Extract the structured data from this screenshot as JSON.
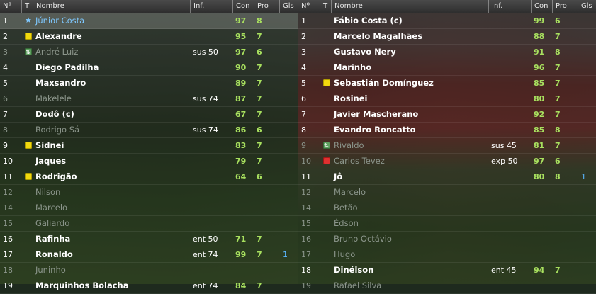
{
  "columns": {
    "num": "Nº",
    "t": "T",
    "name": "Nombre",
    "inf": "Inf.",
    "con": "Con",
    "pro": "Pro",
    "gls": "Gls"
  },
  "left_team": [
    {
      "num": "1",
      "icon": "star",
      "name": "Júnior Costa",
      "inf": "",
      "con": "97",
      "pro": "8",
      "gls": "",
      "style": "accent",
      "selected": true
    },
    {
      "num": "2",
      "icon": "yellow",
      "name": "Alexandre",
      "inf": "",
      "con": "95",
      "pro": "7",
      "gls": "",
      "style": "normal"
    },
    {
      "num": "3",
      "icon": "sub",
      "name": "André Luiz",
      "inf": "sus 50",
      "con": "97",
      "pro": "6",
      "gls": "",
      "style": "dim"
    },
    {
      "num": "4",
      "icon": "",
      "name": "Diego Padilha",
      "inf": "",
      "con": "90",
      "pro": "7",
      "gls": "",
      "style": "normal"
    },
    {
      "num": "5",
      "icon": "",
      "name": "Maxsandro",
      "inf": "",
      "con": "89",
      "pro": "7",
      "gls": "",
      "style": "normal"
    },
    {
      "num": "6",
      "icon": "",
      "name": "Makelele",
      "inf": "sus 74",
      "con": "87",
      "pro": "7",
      "gls": "",
      "style": "dim"
    },
    {
      "num": "7",
      "icon": "",
      "name": "Dodô (c)",
      "inf": "",
      "con": "67",
      "pro": "7",
      "gls": "",
      "style": "normal"
    },
    {
      "num": "8",
      "icon": "",
      "name": "Rodrigo Sá",
      "inf": "sus 74",
      "con": "86",
      "pro": "6",
      "gls": "",
      "style": "dim"
    },
    {
      "num": "9",
      "icon": "yellow",
      "name": "Sidnei",
      "inf": "",
      "con": "83",
      "pro": "7",
      "gls": "",
      "style": "normal"
    },
    {
      "num": "10",
      "icon": "",
      "name": "Jaques",
      "inf": "",
      "con": "79",
      "pro": "7",
      "gls": "",
      "style": "normal"
    },
    {
      "num": "11",
      "icon": "yellow",
      "name": "Rodrigão",
      "inf": "",
      "con": "64",
      "pro": "6",
      "gls": "",
      "style": "normal"
    },
    {
      "num": "12",
      "icon": "",
      "name": "Nilson",
      "inf": "",
      "con": "",
      "pro": "",
      "gls": "",
      "style": "dim"
    },
    {
      "num": "14",
      "icon": "",
      "name": "Marcelo",
      "inf": "",
      "con": "",
      "pro": "",
      "gls": "",
      "style": "dim"
    },
    {
      "num": "15",
      "icon": "",
      "name": "Galiardo",
      "inf": "",
      "con": "",
      "pro": "",
      "gls": "",
      "style": "dim"
    },
    {
      "num": "16",
      "icon": "",
      "name": "Rafinha",
      "inf": "ent 50",
      "con": "71",
      "pro": "7",
      "gls": "",
      "style": "normal"
    },
    {
      "num": "17",
      "icon": "",
      "name": "Ronaldo",
      "inf": "ent 74",
      "con": "99",
      "pro": "7",
      "gls": "1",
      "style": "normal"
    },
    {
      "num": "18",
      "icon": "",
      "name": "Juninho",
      "inf": "",
      "con": "",
      "pro": "",
      "gls": "",
      "style": "dim"
    },
    {
      "num": "19",
      "icon": "",
      "name": "Marquinhos Bolacha",
      "inf": "ent 74",
      "con": "84",
      "pro": "7",
      "gls": "",
      "style": "normal"
    }
  ],
  "right_team": [
    {
      "num": "1",
      "icon": "",
      "name": "Fábio Costa (c)",
      "inf": "",
      "con": "99",
      "pro": "6",
      "gls": "",
      "style": "normal"
    },
    {
      "num": "2",
      "icon": "",
      "name": "Marcelo Magalhães",
      "inf": "",
      "con": "88",
      "pro": "7",
      "gls": "",
      "style": "normal"
    },
    {
      "num": "3",
      "icon": "",
      "name": "Gustavo Nery",
      "inf": "",
      "con": "91",
      "pro": "8",
      "gls": "",
      "style": "normal"
    },
    {
      "num": "4",
      "icon": "",
      "name": "Marinho",
      "inf": "",
      "con": "96",
      "pro": "7",
      "gls": "",
      "style": "normal"
    },
    {
      "num": "5",
      "icon": "yellow",
      "name": "Sebastián Domínguez",
      "inf": "",
      "con": "85",
      "pro": "7",
      "gls": "",
      "style": "normal"
    },
    {
      "num": "6",
      "icon": "",
      "name": "Rosinei",
      "inf": "",
      "con": "80",
      "pro": "7",
      "gls": "",
      "style": "normal"
    },
    {
      "num": "7",
      "icon": "",
      "name": "Javier Mascherano",
      "inf": "",
      "con": "92",
      "pro": "7",
      "gls": "",
      "style": "normal"
    },
    {
      "num": "8",
      "icon": "",
      "name": "Evandro Roncatto",
      "inf": "",
      "con": "85",
      "pro": "8",
      "gls": "",
      "style": "normal"
    },
    {
      "num": "9",
      "icon": "sub",
      "name": "Rivaldo",
      "inf": "sus 45",
      "con": "81",
      "pro": "7",
      "gls": "",
      "style": "dim"
    },
    {
      "num": "10",
      "icon": "red",
      "name": "Carlos Tevez",
      "inf": "exp 50",
      "con": "97",
      "pro": "6",
      "gls": "",
      "style": "dim"
    },
    {
      "num": "11",
      "icon": "",
      "name": "Jô",
      "inf": "",
      "con": "80",
      "pro": "8",
      "gls": "1",
      "style": "normal"
    },
    {
      "num": "12",
      "icon": "",
      "name": "Marcelo",
      "inf": "",
      "con": "",
      "pro": "",
      "gls": "",
      "style": "dim"
    },
    {
      "num": "14",
      "icon": "",
      "name": "Betão",
      "inf": "",
      "con": "",
      "pro": "",
      "gls": "",
      "style": "dim"
    },
    {
      "num": "15",
      "icon": "",
      "name": "Édson",
      "inf": "",
      "con": "",
      "pro": "",
      "gls": "",
      "style": "dim"
    },
    {
      "num": "16",
      "icon": "",
      "name": "Bruno Octávio",
      "inf": "",
      "con": "",
      "pro": "",
      "gls": "",
      "style": "dim"
    },
    {
      "num": "17",
      "icon": "",
      "name": "Hugo",
      "inf": "",
      "con": "",
      "pro": "",
      "gls": "",
      "style": "dim"
    },
    {
      "num": "18",
      "icon": "",
      "name": "Dinélson",
      "inf": "ent 45",
      "con": "94",
      "pro": "7",
      "gls": "",
      "style": "normal"
    },
    {
      "num": "19",
      "icon": "",
      "name": "Rafael Silva",
      "inf": "",
      "con": "",
      "pro": "",
      "gls": "",
      "style": "dim"
    }
  ]
}
